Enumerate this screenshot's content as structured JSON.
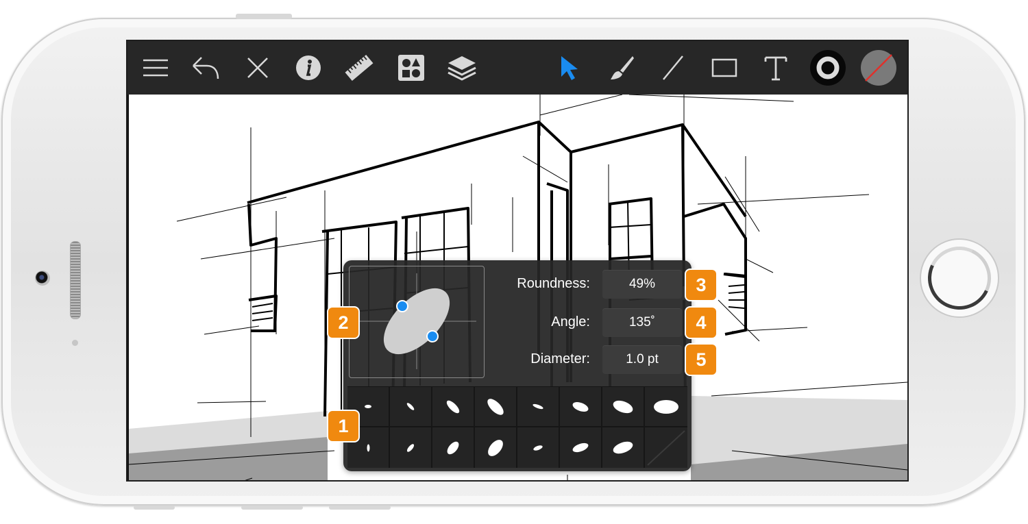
{
  "toolbar": {
    "icons": [
      "menu-icon",
      "undo-icon",
      "close-icon",
      "info-icon",
      "ruler-icon",
      "shapes-icon",
      "layers-icon",
      "pointer-icon",
      "brush-icon",
      "line-icon",
      "rectangle-icon",
      "text-icon",
      "stroke-style-icon",
      "fill-none-icon"
    ],
    "accent": "#1a8cf0"
  },
  "brush_panel": {
    "roundness_label": "Roundness:",
    "roundness_value": "49%",
    "angle_label": "Angle:",
    "angle_value": "135˚",
    "diameter_label": "Diameter:",
    "diameter_value": "1.0 pt",
    "preset_count": 16
  },
  "callouts": {
    "c1": "1",
    "c2": "2",
    "c3": "3",
    "c4": "4",
    "c5": "5",
    "color": "#f0890f"
  }
}
